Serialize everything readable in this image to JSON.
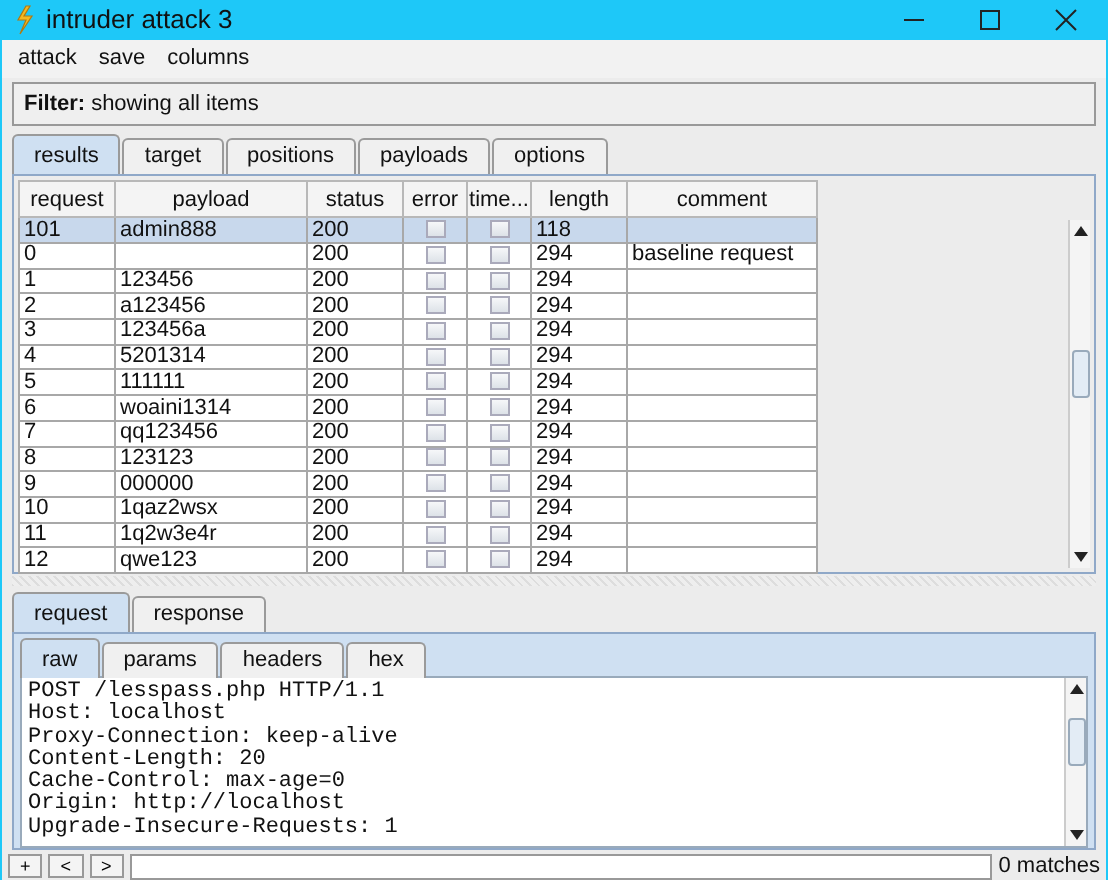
{
  "window": {
    "title": "intruder attack 3"
  },
  "menu": [
    "attack",
    "save",
    "columns"
  ],
  "filter": {
    "label": "Filter:",
    "text": "showing all items"
  },
  "tabs": [
    {
      "label": "results",
      "selected": true
    },
    {
      "label": "target",
      "selected": false
    },
    {
      "label": "positions",
      "selected": false
    },
    {
      "label": "payloads",
      "selected": false
    },
    {
      "label": "options",
      "selected": false
    }
  ],
  "table": {
    "columns": [
      "request",
      "payload",
      "status",
      "error",
      "time...",
      "length",
      "comment"
    ],
    "rows": [
      {
        "request": "101",
        "payload": "admin888",
        "status": "200",
        "error": false,
        "timeout": false,
        "length": "118",
        "selected": true
      },
      {
        "request": "0",
        "status": "200",
        "error": false,
        "timeout": false,
        "length": "294",
        "comment": "baseline request",
        "selected": false
      },
      {
        "request": "1",
        "payload": "123456",
        "status": "200",
        "error": false,
        "timeout": false,
        "length": "294",
        "selected": false
      },
      {
        "request": "2",
        "payload": "a123456",
        "status": "200",
        "error": false,
        "timeout": false,
        "length": "294",
        "selected": false
      },
      {
        "request": "3",
        "payload": "123456a",
        "status": "200",
        "error": false,
        "timeout": false,
        "length": "294",
        "selected": false
      },
      {
        "request": "4",
        "payload": "5201314",
        "status": "200",
        "error": false,
        "timeout": false,
        "length": "294",
        "selected": false
      },
      {
        "request": "5",
        "payload": "111111",
        "status": "200",
        "error": false,
        "timeout": false,
        "length": "294",
        "selected": false
      },
      {
        "request": "6",
        "payload": "woaini1314",
        "status": "200",
        "error": false,
        "timeout": false,
        "length": "294",
        "selected": false
      },
      {
        "request": "7",
        "payload": "qq123456",
        "status": "200",
        "error": false,
        "timeout": false,
        "length": "294",
        "selected": false
      },
      {
        "request": "8",
        "payload": "123123",
        "status": "200",
        "error": false,
        "timeout": false,
        "length": "294",
        "selected": false
      },
      {
        "request": "9",
        "payload": "000000",
        "status": "200",
        "error": false,
        "timeout": false,
        "length": "294",
        "selected": false
      },
      {
        "request": "10",
        "payload": "1qaz2wsx",
        "status": "200",
        "error": false,
        "timeout": false,
        "length": "294",
        "selected": false
      },
      {
        "request": "11",
        "payload": "1q2w3e4r",
        "status": "200",
        "error": false,
        "timeout": false,
        "length": "294",
        "selected": false
      },
      {
        "request": "12",
        "payload": "qwe123",
        "status": "200",
        "error": false,
        "timeout": false,
        "length": "294",
        "selected": false
      }
    ]
  },
  "detail_tabs": [
    {
      "label": "request",
      "selected": true
    },
    {
      "label": "response",
      "selected": false
    }
  ],
  "view_tabs": [
    {
      "label": "raw",
      "selected": true
    },
    {
      "label": "params",
      "selected": false
    },
    {
      "label": "headers",
      "selected": false
    },
    {
      "label": "hex",
      "selected": false
    }
  ],
  "request_lines": [
    "POST /lesspass.php HTTP/1.1",
    "Host: localhost",
    "Proxy-Connection: keep-alive",
    "Content-Length: 20",
    "Cache-Control: max-age=0",
    "Origin: http://localhost",
    "Upgrade-Insecure-Requests: 1"
  ],
  "search": {
    "buttons": [
      "+",
      "<",
      ">"
    ],
    "matches": "0 matches"
  }
}
